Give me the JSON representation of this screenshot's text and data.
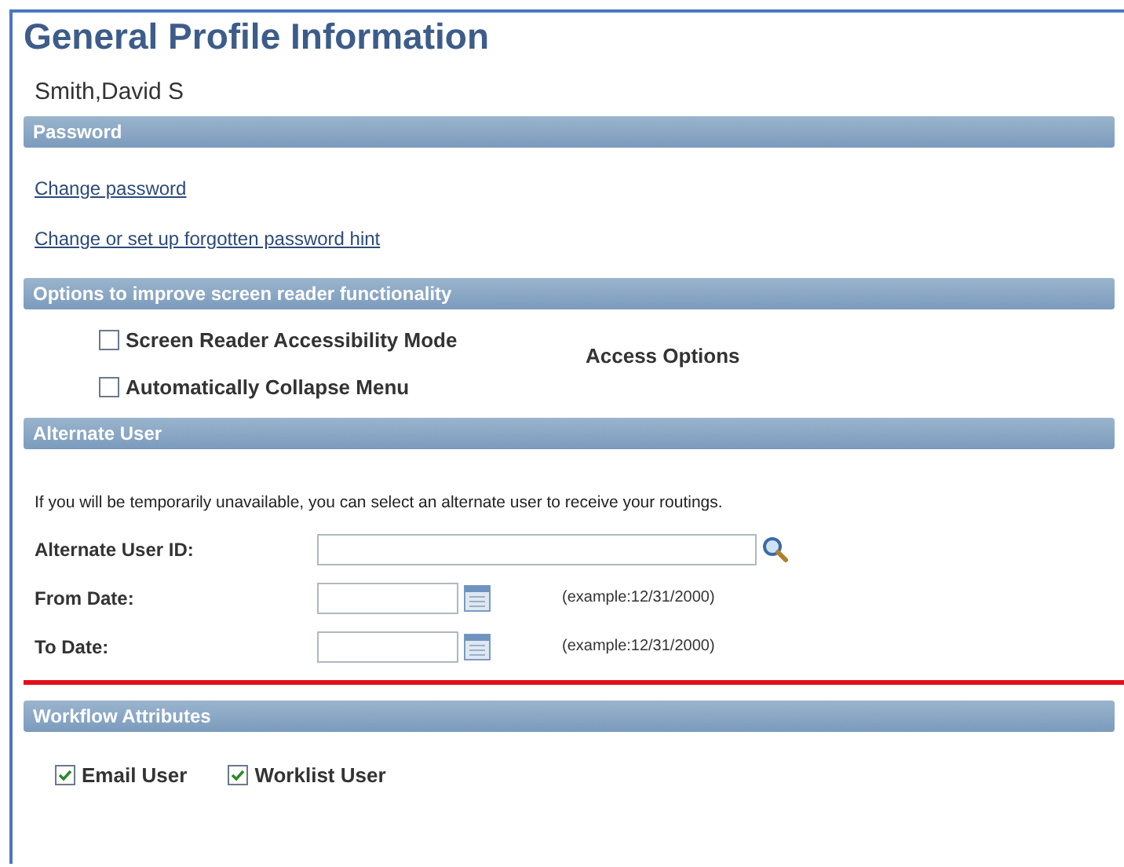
{
  "page_title": "General Profile Information",
  "user_name": "Smith,David S",
  "sections": [
    {
      "kind": "links",
      "title": "Password",
      "links": [
        "Change password",
        "Change or set up forgotten password hint"
      ]
    },
    {
      "kind": "options",
      "title": "Options to improve screen reader functionality",
      "checkboxes": [
        {
          "label": "Screen Reader Accessibility Mode",
          "checked": false
        },
        {
          "label": "Automatically Collapse Menu",
          "checked": false
        }
      ],
      "side_label": "Access Options"
    },
    {
      "kind": "form",
      "title": "Alternate User",
      "instruction": "If you will be temporarily unavailable, you can select an alternate user to receive your routings.",
      "fields": [
        {
          "kind": "lookup",
          "label": "Alternate User ID:"
        },
        {
          "kind": "date",
          "label": "From Date:",
          "hint": "(example:12/31/2000)"
        },
        {
          "kind": "date",
          "label": "To Date:",
          "hint": "(example:12/31/2000)"
        }
      ]
    },
    {
      "kind": "inline_checks",
      "title": "Workflow Attributes",
      "checkboxes": [
        {
          "label": "Email User",
          "checked": true
        },
        {
          "label": "Worklist User",
          "checked": true
        }
      ]
    }
  ]
}
